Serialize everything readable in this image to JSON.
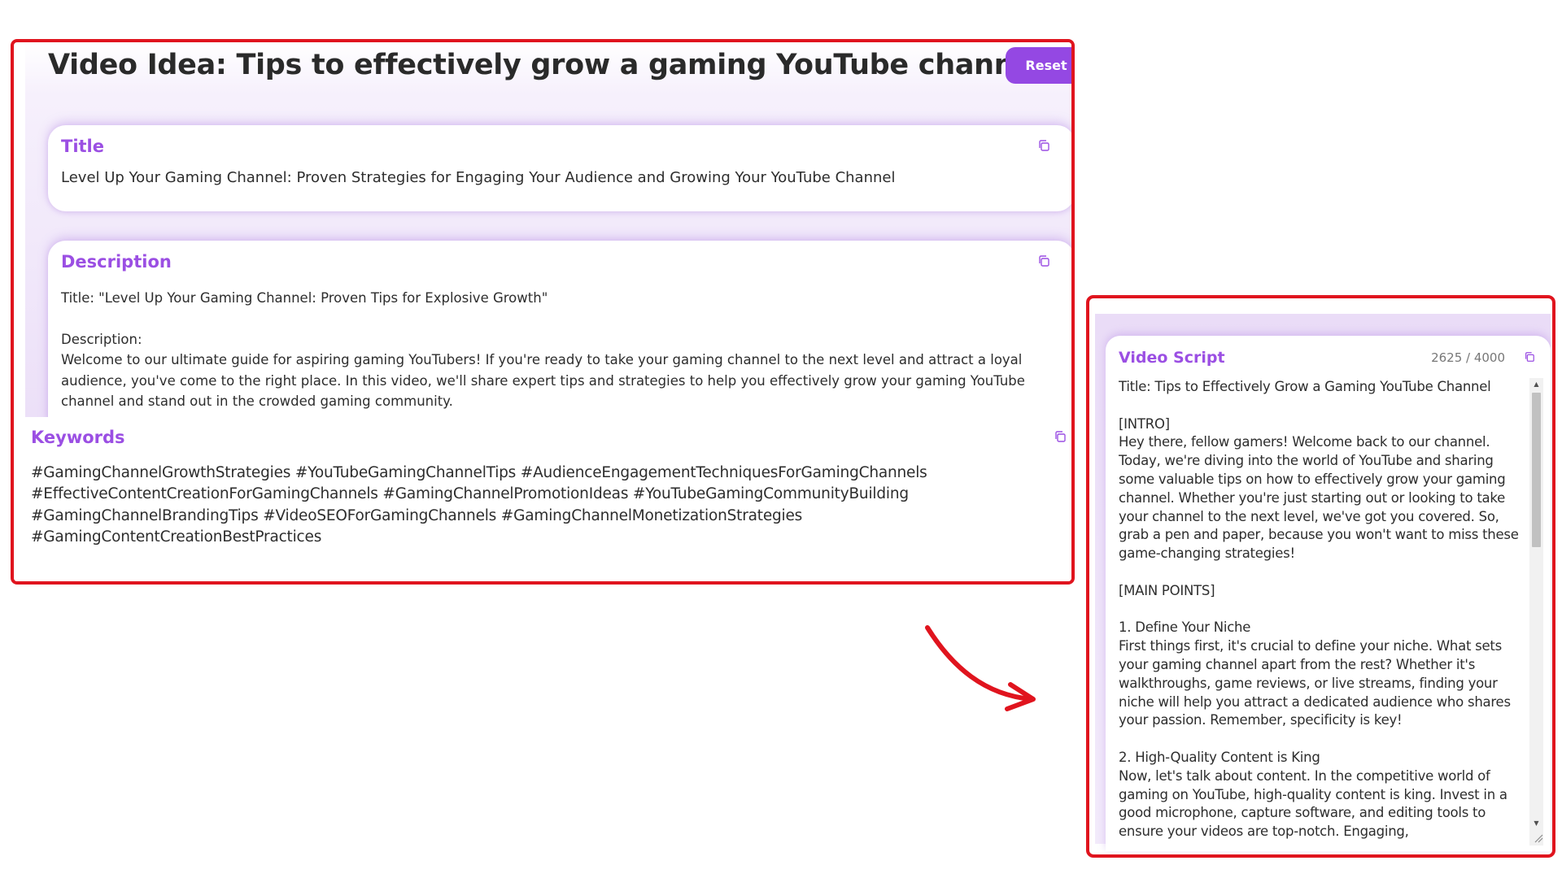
{
  "page": {
    "title": "Video Idea: Tips to effectively grow a gaming YouTube channel",
    "reset_label": "Reset"
  },
  "title_card": {
    "heading": "Title",
    "text": "Level Up Your Gaming Channel: Proven Strategies for Engaging Your Audience and Growing Your YouTube Channel",
    "copy_icon": "copy-icon"
  },
  "description_card": {
    "heading": "Description",
    "line1": "Title: \"Level Up Your Gaming Channel: Proven Tips for Explosive Growth\"",
    "label": "Description:",
    "paragraph": "Welcome to our ultimate guide for aspiring gaming YouTubers! If you're ready to take your gaming channel to the next level and attract a loyal audience, you've come to the right place. In this video, we'll share expert tips and strategies to help you effectively grow your gaming YouTube channel and stand out in the crowded gaming community.",
    "copy_icon": "copy-icon"
  },
  "keywords": {
    "heading": "Keywords",
    "text": "#GamingChannelGrowthStrategies #YouTubeGamingChannelTips #AudienceEngagementTechniquesForGamingChannels #EffectiveContentCreationForGamingChannels #GamingChannelPromotionIdeas #YouTubeGamingCommunityBuilding #GamingChannelBrandingTips #VideoSEOForGamingChannels #GamingChannelMonetizationStrategies #GamingContentCreationBestPractices",
    "copy_icon": "copy-icon"
  },
  "video_script": {
    "heading": "Video Script",
    "char_count": "2625 / 4000",
    "copy_icon": "copy-icon",
    "title_line": "Title: Tips to Effectively Grow a Gaming YouTube Channel",
    "intro_tag": "[INTRO]",
    "intro_text": "Hey there, fellow gamers! Welcome back to our channel. Today, we're diving into the world of YouTube and sharing some valuable tips on how to effectively grow your gaming channel. Whether you're just starting out or looking to take your channel to the next level, we've got you covered. So, grab a pen and paper, because you won't want to miss these game-changing strategies!",
    "main_tag": "[MAIN POINTS]",
    "point1_heading": "1. Define Your Niche",
    "point1_text": "First things first, it's crucial to define your niche. What sets your gaming channel apart from the rest? Whether it's walkthroughs, game reviews, or live streams, finding your niche will help you attract a dedicated audience who shares your passion. Remember, specificity is key!",
    "point2_heading": "2. High-Quality Content is King",
    "point2_text": "Now, let's talk about content. In the competitive world of gaming on YouTube, high-quality content is king. Invest in a good microphone, capture software, and editing tools to ensure your videos are top-notch. Engaging,"
  },
  "colors": {
    "accent": "#9b4fe3",
    "button": "#9448e3",
    "annotation": "#e0141e"
  }
}
